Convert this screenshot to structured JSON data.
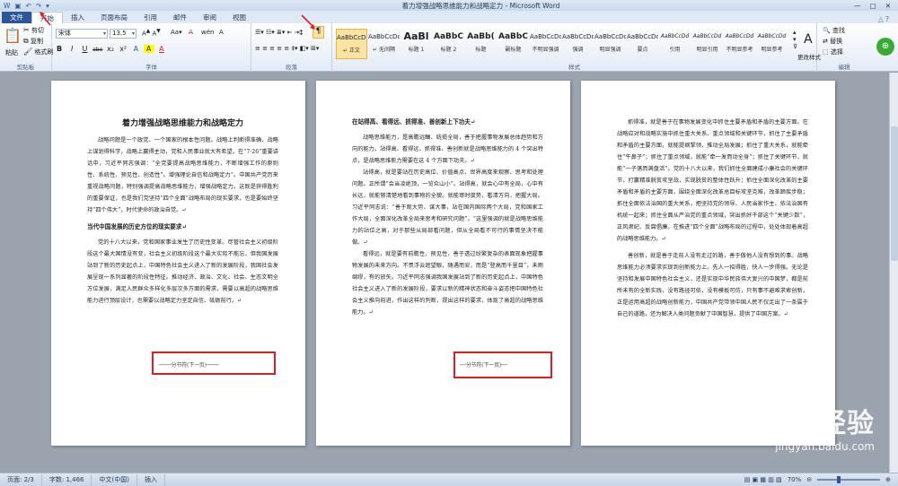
{
  "window": {
    "title": "着力增强战略思维能力和战略定力 - Microsoft Word",
    "controls": [
      "—",
      "□",
      "✕"
    ]
  },
  "quick_access": {
    "icons": [
      "word-logo-icon",
      "save-icon",
      "undo-icon",
      "redo-icon",
      "customize-icon"
    ]
  },
  "tabs": [
    {
      "label": "文件"
    },
    {
      "label": "开始"
    },
    {
      "label": "插入"
    },
    {
      "label": "页面布局"
    },
    {
      "label": "引用"
    },
    {
      "label": "邮件"
    },
    {
      "label": "审阅"
    },
    {
      "label": "视图"
    }
  ],
  "ribbon": {
    "clipboard": {
      "paste": "粘贴",
      "cut": "剪切",
      "copy": "复制",
      "painter": "格式刷",
      "label": "剪贴板"
    },
    "font": {
      "name": "宋体",
      "size": "13.5",
      "label": "字体",
      "buttons": [
        "B",
        "I",
        "U",
        "abe",
        "x₂",
        "x²",
        "A",
        "A",
        "A"
      ]
    },
    "paragraph": {
      "label": "段落"
    },
    "styles": {
      "label": "样式",
      "items": [
        {
          "preview": "AaBbCcDd",
          "name": "↵ 正文"
        },
        {
          "preview": "AaBbCcDd",
          "name": "↵ 无间隔"
        },
        {
          "preview": "AaBl",
          "name": "标题 1"
        },
        {
          "preview": "AaBbC",
          "name": "标题 2"
        },
        {
          "preview": "AaBb(",
          "name": "标题"
        },
        {
          "preview": "AaBbC",
          "name": "副标题"
        },
        {
          "preview": "AaBbCcDd",
          "name": "不明显强调"
        },
        {
          "preview": "AaBbCcDd",
          "name": "强调"
        },
        {
          "preview": "AaBbCcDd",
          "name": "明显强调"
        },
        {
          "preview": "AaBbCcDd",
          "name": "要点"
        },
        {
          "preview": "AaBbCcDd",
          "name": "引用"
        },
        {
          "preview": "AaBbCcDd",
          "name": "明显引用"
        },
        {
          "preview": "AaBbCcDd",
          "name": "不明显参考"
        },
        {
          "preview": "AaBbCcDd",
          "name": "明显参考"
        }
      ],
      "change": "更改样式"
    },
    "editing": {
      "find": "查找",
      "replace": "替换",
      "select": "选择",
      "label": "编辑"
    }
  },
  "pages": [
    {
      "title": "着力增强战略思维能力和战略定力",
      "paragraphs": [
        "战略问题是一个政党、一个国家的根本性问题。战略上判断得准确，战略上谋划得科学，战略上赢得主动，党和人民事业就大有希望。在“7·26”重要讲话中，习近平同志强调：“全党要提高战略思维能力，不断增强工作的原则性、系统性、预见性、创造性”。增强理论自信和战略定力”。中国共产党历来重视战略问题，特别强调提高战略思维能力，增强战略定力。这既是获得胜利的重要保证，也是我们党坚持“四个全面”战略布局的现实要求，也是要始终坚持“四个伟大”，时代使命的政治自觉。↵"
      ],
      "heading": "当代中国发展的历史方位的现实要求↵",
      "paragraphs2": [
        "党的十八大以来，党和国家事业发生了历史性变革。尽管社会主义初级阶段这个最大国情没有变，社会主义初级阶段这个最大实际不能忘，但我国发展站到了新的历史起点上，中国特色社会主义进入了新的发展阶段，我国社会发展呈现一系列显著的阶段性特征。推动经济、政治、文化、社会、生态文明全方位发展，满足人民群众多样化多层次多方面的需求，需要以高超的战略思维能力进行顶层设计，也需要以战略定力坚定自信、砥砺前行。↵"
      ],
      "section_break": "分节符(下一页)"
    },
    {
      "heading": "在站得高、看得远、抓得准、善创新上下功夫↵",
      "paragraphs": [
        "战略思维能力，是高瞻远瞩、统揽全局，善于把握事物发展总体趋势和方向的能力。站得高、看得远、抓得准、善创新就是战略思维能力的 4 个突出特点，是战略思维能力需要在这 4 个方面下功夫。↵",
        "站得高，就是要站在历史高位、价值高点、世界高度来观察、思考和处理问题。正所谓“会当凌绝顶，一览众山小”。站得高，就会心中有全局，心中有长远，就能够清楚地看到事物的全貌。就能审时度势，看清方向，把握大局。习近平同志说：“善于观大势、谋大事，站在国内国际两个大局，党和国家工作大局，全面深化改革全局来思考和研究问题”。“这里强调的就是战略思维能力的站位之高，对于那些从局部看问题，但从全局看不可行的事情坚决不能做。↵",
        "看得远，就是要有前瞻性、预见性，善于透过纷繁复杂的表面现象把握事物发展的未来方向。不畏浮云遮望眼，随遇而安，而是“登高而千里目”，未雨绸缪，有的放矢。习近平同志强调我国发展站到了新的历史起点上，中国特色社会主义进入了新的发展阶段，要求以新的精神状态和奋斗姿态把中国特色社会主义推向前进，作出这样的判断，提出这样的要求，体现了高超的战略思维能力。↵"
      ],
      "section_break": "分节符(下一页)"
    },
    {
      "paragraphs": [
        "抓得准，就是善于在事物发展变化中抓住主要矛盾和矛盾的主要方面。在战略应对和战略实施中抓住重大关系、重点领域和关键环节，抓住了主要矛盾和矛盾的主要方面，就能提纲挈领，推动全局发展；抓住了重大关系，就能牵住“牛鼻子”；抓住了重点领域，就能“牵一发而动全身”；抓住了关键环节，就能“一子落而满盘活”。党的十八大以来，我们抓住全面建成小康社会的关键环节，打赢精准脱贫攻坚战，实现脱贫的整体性跃升；抓住全面深化改革的主要矛盾和矛盾的主要方面，围绕全面深化改革总目标攻坚克难，改革蹄疾步稳；抓住全面依法治国的重大关系，把坚持党的领导、人民当家作主、依法治国有机统一起来；抓住全面从严治党的重点领域，突出抓好干部这个“关键少数”，正风肃纪、反腐倡廉。在推进“四个全面”战略布局的过程中，处处体现着高超的战略思维能力。↵",
        "善创新，就是善于走前人没有走过的路，善于做他人没有想到的事。战略思维能力必须要求实现到创新能力上。先人一招得胜，快人一步得强。无论是坚持和发展中国特色社会主义，还是实现中华民族伟大复兴的中国梦，都是前所未有的全新实践，没有路径可依，没有模板可仿，只有事不避难求索创新，正是运用高超的战略创新能力，中国共产党带领中国人民不仅走出了一条属于自己的道路，还为解决人类问题贡献了中国智慧，提供了中国方案。↵"
      ]
    }
  ],
  "status": {
    "page": "页面: 2/3",
    "words": "字数: 1,466",
    "lang": "中文(中国)",
    "mode": "插入",
    "zoom": "70%"
  },
  "watermark": {
    "logo": "Bai⊕经验",
    "url": "jingyan.baidu.com"
  }
}
